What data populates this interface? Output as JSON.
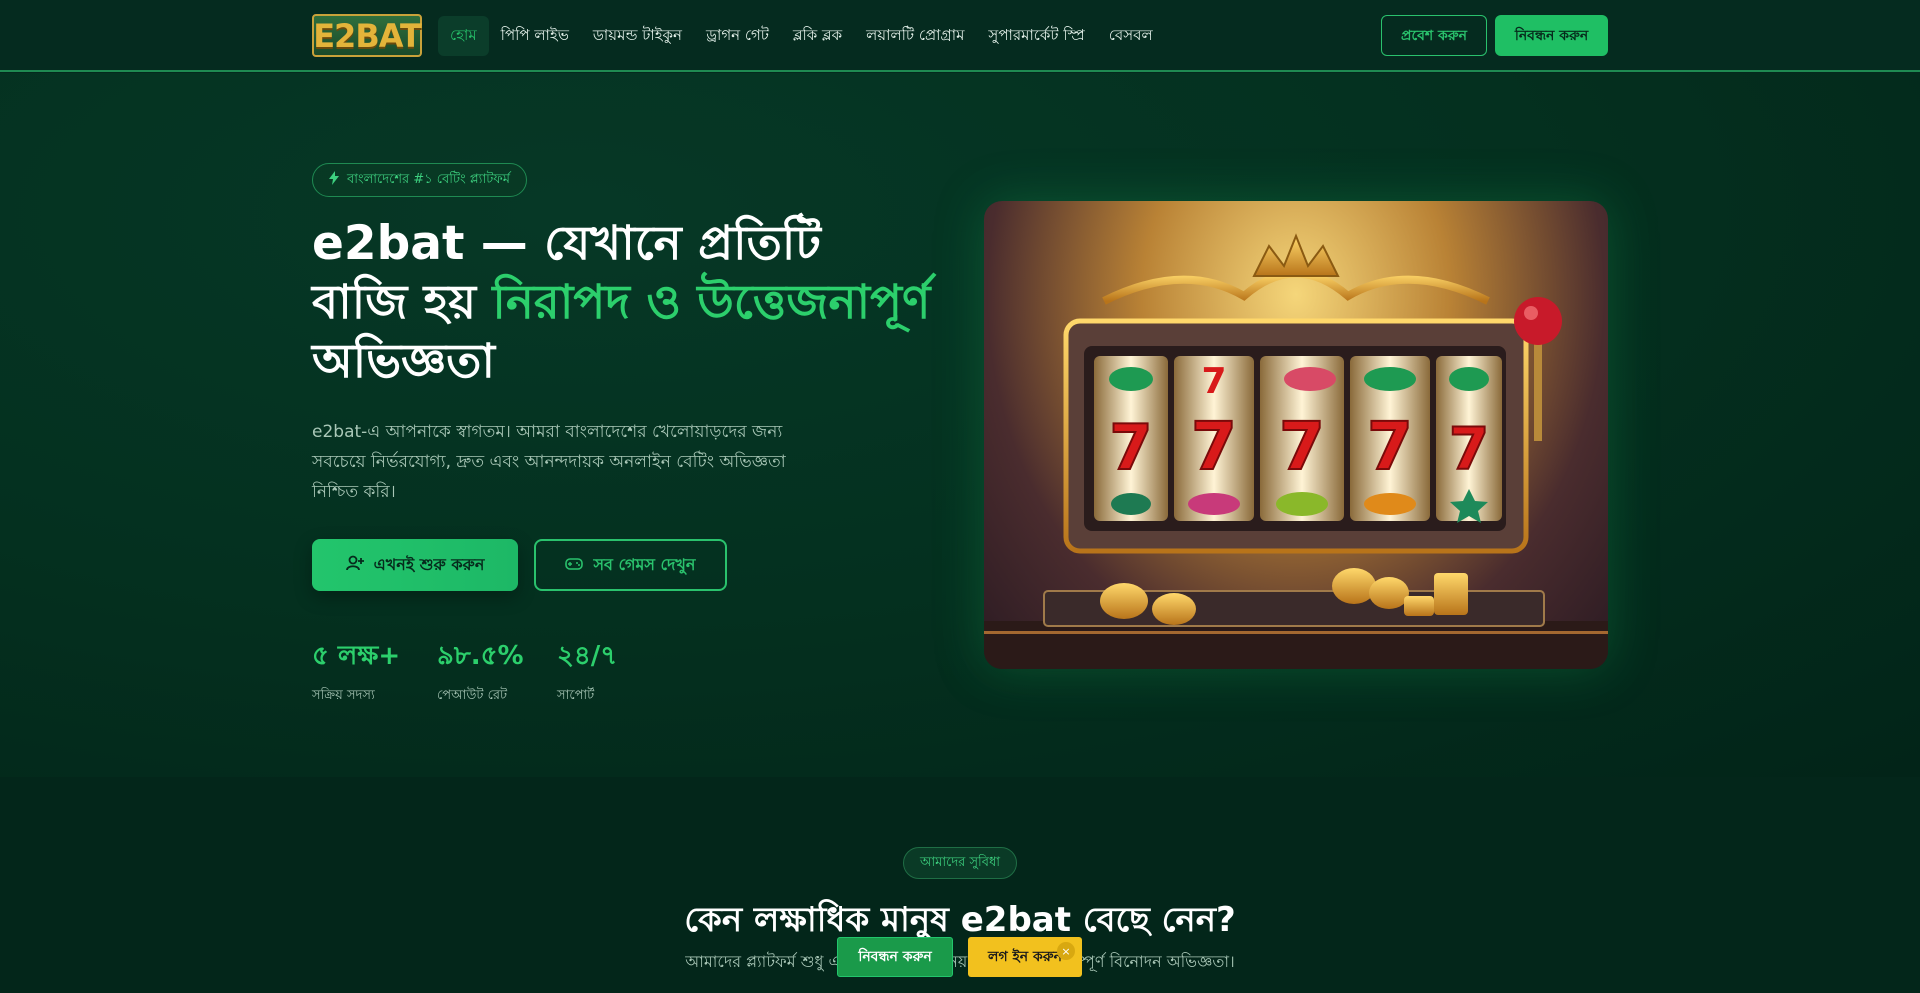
{
  "header": {
    "logo_text": "E2BAT",
    "nav": [
      {
        "label": "হোম",
        "active": true
      },
      {
        "label": "পিপি লাইভ"
      },
      {
        "label": "ডায়মন্ড টাইকুন"
      },
      {
        "label": "ড্রাগন গেট"
      },
      {
        "label": "ব্লকি ব্লক"
      },
      {
        "label": "লয়ালটি প্রোগ্রাম"
      },
      {
        "label": "সুপারমার্কেট স্প্রি"
      },
      {
        "label": "বেসবল"
      }
    ],
    "login_label": "প্রবেশ করুন",
    "register_label": "নিবন্ধন করুন"
  },
  "hero": {
    "badge": "বাংলাদেশের #১ বেটিং প্ল্যাটফর্ম",
    "headline_part1": "e2bat — যেখানে প্রতিটি বাজি হয় ",
    "headline_highlight": "নিরাপদ ও উত্তেজনাপূর্ণ",
    "headline_part2": " অভিজ্ঞতা",
    "description": "e2bat-এ আপনাকে স্বাগতম। আমরা বাংলাদেশের খেলোয়াড়দের জন্য সবচেয়ে নির্ভরযোগ্য, দ্রুত এবং আনন্দদায়ক অনলাইন বেটিং অভিজ্ঞতা নিশ্চিত করি।",
    "cta_primary": "এখনই শুরু করুন",
    "cta_secondary": "সব গেমস দেখুন",
    "stats": [
      {
        "value": "৫ লক্ষ+",
        "label": "সক্রিয় সদস্য"
      },
      {
        "value": "৯৮.৫%",
        "label": "পেআউট রেট"
      },
      {
        "value": "২৪/৭",
        "label": "সাপোর্ট"
      }
    ]
  },
  "features": {
    "badge": "আমাদের সুবিধা",
    "title": "কেন লক্ষাধিক মানুষ e2bat বেছে নেন?",
    "subtitle": "আমাদের প্ল্যাটফর্ম শুধু একটি বেটিং সাইট নয় — এটি একটি সম্পূর্ণ বিনোদন অভিজ্ঞতা।"
  },
  "sticky": {
    "register_label": "নিবন্ধন করুন",
    "login_label": "লগ ইন করুন",
    "close_glyph": "×"
  },
  "colors": {
    "accent": "#1fbf64",
    "background": "#04291d",
    "sticky_login": "#f2c11e"
  }
}
